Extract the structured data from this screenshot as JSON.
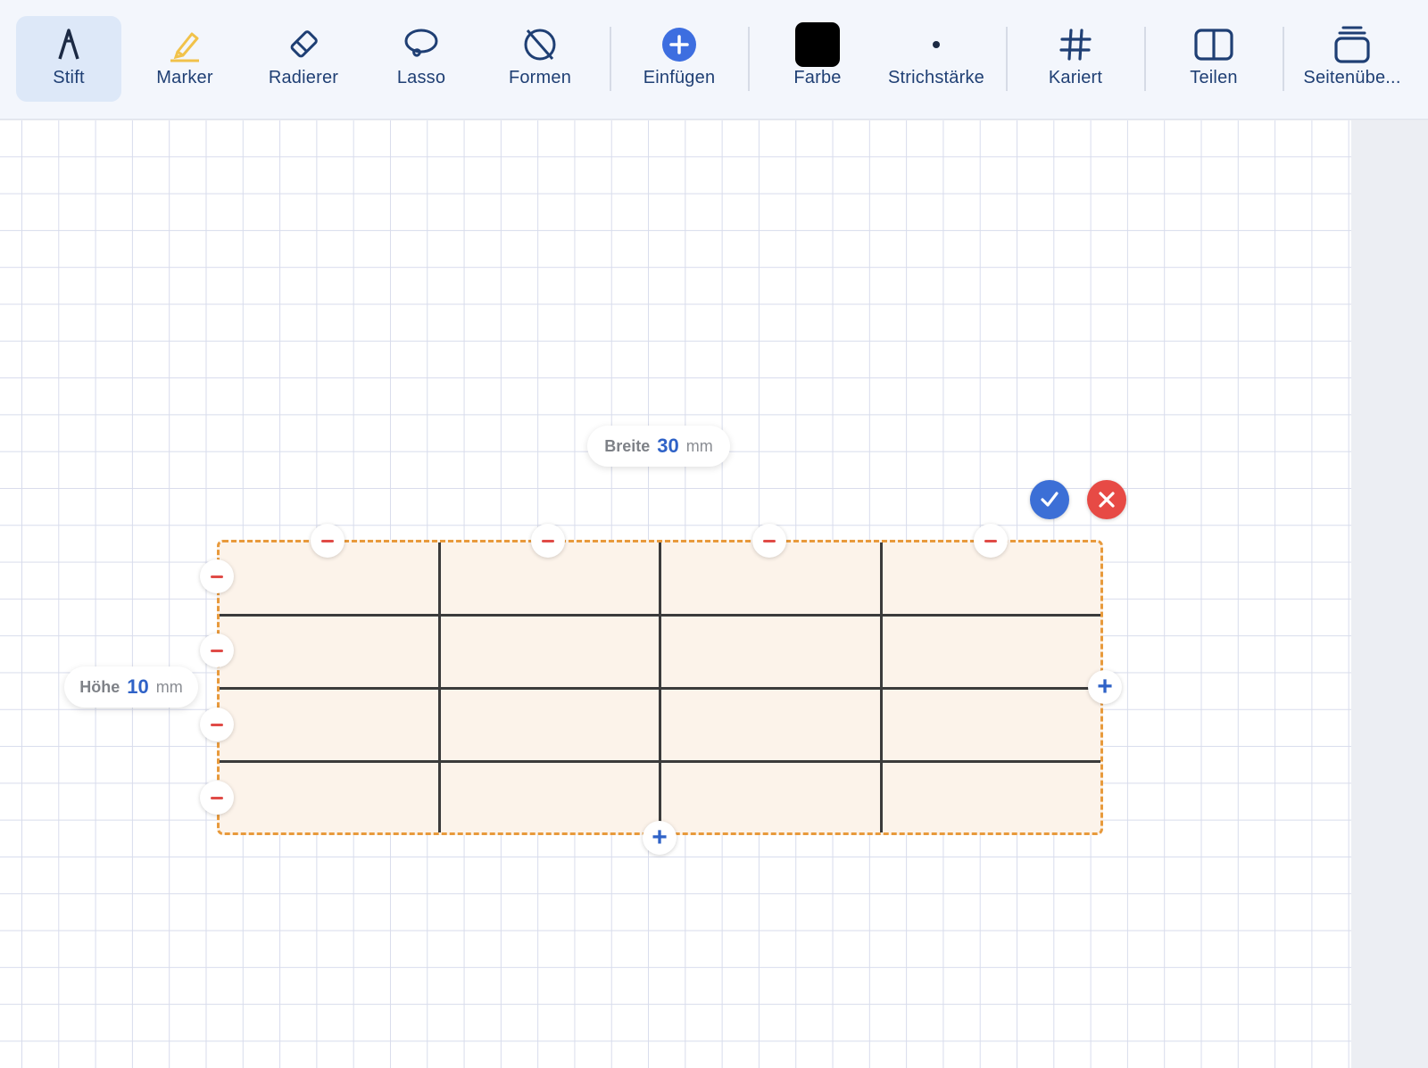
{
  "toolbar": {
    "tools": [
      {
        "label": "Stift",
        "icon": "pen-icon",
        "active": true
      },
      {
        "label": "Marker",
        "icon": "highlighter-icon"
      },
      {
        "label": "Radierer",
        "icon": "eraser-icon"
      },
      {
        "label": "Lasso",
        "icon": "lasso-icon"
      },
      {
        "label": "Formen",
        "icon": "shapes-icon"
      },
      {
        "label": "Einfügen",
        "icon": "plus-circle-icon"
      },
      {
        "label": "Farbe",
        "icon": "color-swatch"
      },
      {
        "label": "Strichstärke",
        "icon": "stroke-dot-icon"
      },
      {
        "label": "Kariert",
        "icon": "grid-hash-icon"
      },
      {
        "label": "Teilen",
        "icon": "split-view-icon"
      },
      {
        "label": "Seitenübe...",
        "icon": "page-stack-icon"
      }
    ],
    "selected_color": "#000000"
  },
  "table_editor": {
    "width_pill": {
      "label": "Breite",
      "value": "30",
      "unit": "mm"
    },
    "height_pill": {
      "label": "Höhe",
      "value": "10",
      "unit": "mm"
    },
    "columns": 4,
    "rows": 4,
    "selection_color": "#e89a3c",
    "confirm_icon": "checkmark-icon",
    "cancel_icon": "close-icon"
  }
}
